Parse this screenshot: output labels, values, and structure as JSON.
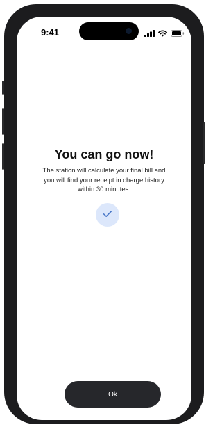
{
  "status_bar": {
    "time": "9:41",
    "icons": [
      "cellular-signal-icon",
      "wifi-icon",
      "battery-icon"
    ]
  },
  "confirmation": {
    "title": "You can go now!",
    "message_lines": [
      "The station will calculate your final bill and",
      "you will find your receipt in charge history",
      "within 30 minutes."
    ],
    "icon": "checkmark-icon"
  },
  "actions": {
    "ok_label": "Ok"
  },
  "colors": {
    "button_bg": "#26272b",
    "check_circle_bg": "#dce7fb",
    "check_color": "#4a78c8"
  }
}
